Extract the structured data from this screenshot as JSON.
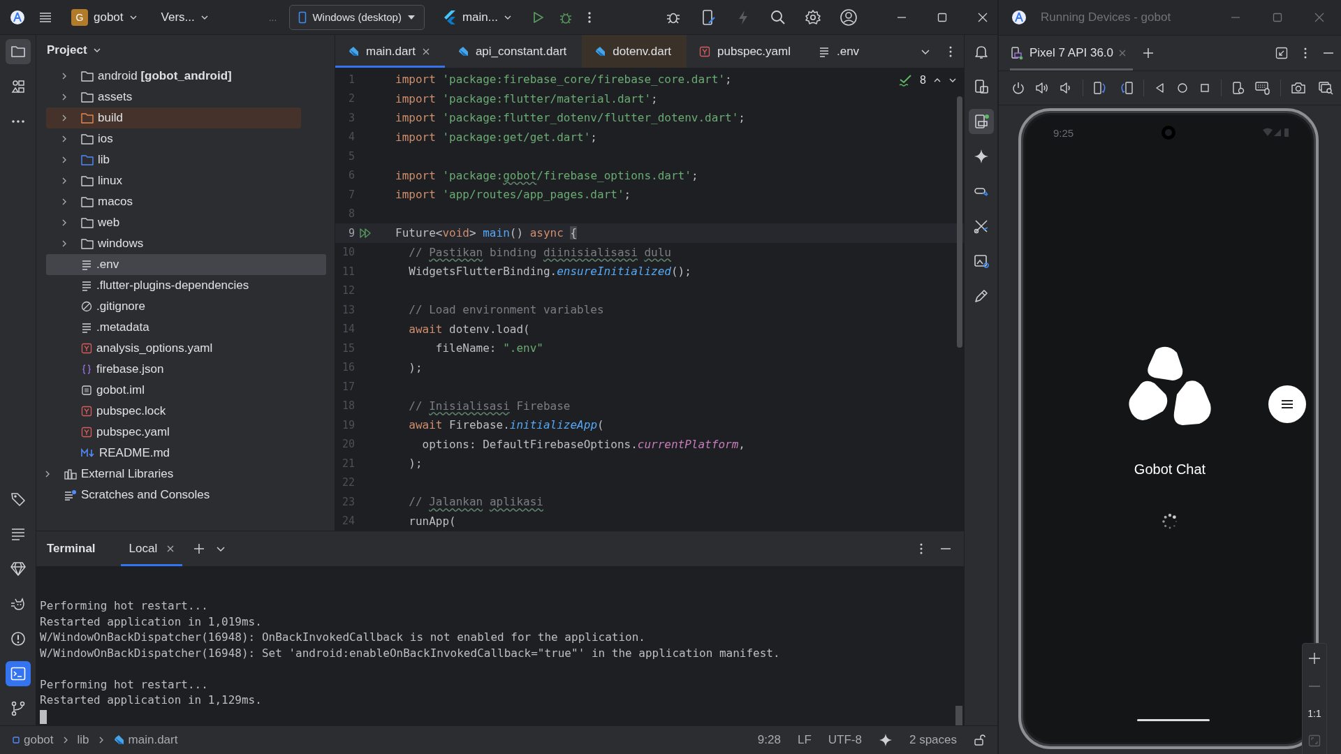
{
  "toolbar": {
    "badge": "G",
    "project": "gobot",
    "vcs": "Vers...",
    "overflow": "...",
    "device": "Windows (desktop)",
    "run_config": "main..."
  },
  "left_strip": {
    "top": [
      {
        "selected": true
      },
      {
        "selected": false
      },
      {
        "selected": false
      }
    ],
    "bottom": [
      {
        "selected": false
      },
      {
        "selected": false
      },
      {
        "selected": false
      },
      {
        "selected": false
      },
      {
        "selected": false
      },
      {
        "selected": true
      },
      {
        "selected": false
      }
    ]
  },
  "right_strip": [
    {
      "selected": false
    },
    {
      "selected": false
    },
    {
      "selected": true
    },
    {
      "selected": false
    },
    {
      "selected": false
    },
    {
      "selected": false
    },
    {
      "selected": false
    },
    {
      "selected": false
    }
  ],
  "project": {
    "title": "Project",
    "tree": [
      {
        "label": "android **[gobot_android]**",
        "kind": "folder",
        "expanded": false,
        "selected": false
      },
      {
        "label": "assets",
        "kind": "folder",
        "expanded": false,
        "selected": false
      },
      {
        "label": "build",
        "kind": "excluded_folder",
        "expanded": false,
        "selected": false
      },
      {
        "label": "ios",
        "kind": "folder",
        "expanded": false,
        "selected": false
      },
      {
        "label": "lib",
        "kind": "source_folder",
        "expanded": false,
        "selected": false
      },
      {
        "label": "linux",
        "kind": "folder",
        "expanded": false,
        "selected": false
      },
      {
        "label": "macos",
        "kind": "folder",
        "expanded": false,
        "selected": false
      },
      {
        "label": "web",
        "kind": "folder",
        "expanded": false,
        "selected": false
      },
      {
        "label": "windows",
        "kind": "folder",
        "expanded": false,
        "selected": false
      },
      {
        "label": ".env",
        "kind": "text",
        "selected": true
      },
      {
        "label": ".flutter-plugins-dependencies",
        "kind": "text",
        "selected": false
      },
      {
        "label": ".gitignore",
        "kind": "ignore",
        "selected": false
      },
      {
        "label": ".metadata",
        "kind": "text",
        "selected": false
      },
      {
        "label": "analysis_options.yaml",
        "kind": "yaml",
        "selected": false
      },
      {
        "label": "firebase.json",
        "kind": "json",
        "selected": false
      },
      {
        "label": "gobot.iml",
        "kind": "iml",
        "selected": false
      },
      {
        "label": "pubspec.lock",
        "kind": "yaml",
        "selected": false
      },
      {
        "label": "pubspec.yaml",
        "kind": "yaml",
        "selected": false
      },
      {
        "label": "README.md",
        "kind": "markdown",
        "selected": false
      }
    ],
    "extra": [
      {
        "label": "External Libraries",
        "kind": "libraries",
        "expanded": false,
        "selected": false
      },
      {
        "label": "Scratches and Consoles",
        "kind": "scratches",
        "selected": false
      }
    ]
  },
  "editor": {
    "tabs": [
      {
        "label": "main.dart",
        "kind": "dart",
        "selected": true,
        "closable": true,
        "excluded": false
      },
      {
        "label": "api_constant.dart",
        "kind": "dart",
        "selected": false,
        "closable": false,
        "excluded": false
      },
      {
        "label": "dotenv.dart",
        "kind": "dart",
        "selected": false,
        "closable": false,
        "excluded": true
      },
      {
        "label": "pubspec.yaml",
        "kind": "yaml",
        "selected": false,
        "closable": false,
        "excluded": false
      },
      {
        "label": ".env",
        "kind": "text",
        "selected": false,
        "closable": false,
        "excluded": false
      }
    ],
    "inspections": "8",
    "lines": [
      {
        "n": "1",
        "current": false,
        "run": false,
        "tokens": [
          {
            "t": "import ",
            "kind": "kw"
          },
          {
            "t": "'package:firebase_core/firebase_core.dart'",
            "kind": "str"
          },
          {
            "t": ";",
            "kind": "p"
          }
        ]
      },
      {
        "n": "2",
        "current": false,
        "run": false,
        "tokens": [
          {
            "t": "import ",
            "kind": "kw"
          },
          {
            "t": "'package:flutter/material.dart'",
            "kind": "str"
          },
          {
            "t": ";",
            "kind": "p"
          }
        ]
      },
      {
        "n": "3",
        "current": false,
        "run": false,
        "tokens": [
          {
            "t": "import ",
            "kind": "kw"
          },
          {
            "t": "'package:flutter_dotenv/flutter_dotenv.dart'",
            "kind": "str"
          },
          {
            "t": ";",
            "kind": "p"
          }
        ]
      },
      {
        "n": "4",
        "current": false,
        "run": false,
        "tokens": [
          {
            "t": "import ",
            "kind": "kw"
          },
          {
            "t": "'package:get/get.dart'",
            "kind": "str"
          },
          {
            "t": ";",
            "kind": "p"
          }
        ]
      },
      {
        "n": "5",
        "current": false,
        "run": false
      },
      {
        "n": "6",
        "current": false,
        "run": false,
        "tokens": [
          {
            "t": "import ",
            "kind": "kw"
          },
          {
            "t": "'package:",
            "kind": "str"
          },
          {
            "t": "gobot",
            "kind": "str_typo"
          },
          {
            "t": "/firebase_options.dart'",
            "kind": "str"
          },
          {
            "t": ";",
            "kind": "p"
          }
        ]
      },
      {
        "n": "7",
        "current": false,
        "run": false,
        "tokens": [
          {
            "t": "import ",
            "kind": "kw"
          },
          {
            "t": "'app/routes/app_pages.dart'",
            "kind": "str"
          },
          {
            "t": ";",
            "kind": "p"
          }
        ]
      },
      {
        "n": "8",
        "current": false,
        "run": false
      },
      {
        "n": "9",
        "current": true,
        "run": true,
        "tokens": [
          {
            "t": "Future<",
            "kind": "p"
          },
          {
            "t": "void",
            "kind": "kw"
          },
          {
            "t": "> ",
            "kind": "p"
          },
          {
            "t": "main",
            "kind": "fn"
          },
          {
            "t": "() ",
            "kind": "p"
          },
          {
            "t": "async ",
            "kind": "kw"
          },
          {
            "t": "{",
            "kind": "brace"
          }
        ]
      },
      {
        "n": "10",
        "current": false,
        "run": false,
        "tokens": [
          {
            "t": "  // ",
            "kind": "cm"
          },
          {
            "t": "Pastikan",
            "kind": "cm_typo"
          },
          {
            "t": " binding ",
            "kind": "cm"
          },
          {
            "t": "diinisialisasi",
            "kind": "cm_typo"
          },
          {
            "t": " dulu",
            "kind": "cm_typo"
          }
        ]
      },
      {
        "n": "11",
        "current": false,
        "run": false,
        "tokens": [
          {
            "t": "  WidgetsFlutterBinding.",
            "kind": "p"
          },
          {
            "t": "ensureInitialized",
            "kind": "it"
          },
          {
            "t": "();",
            "kind": "p"
          }
        ]
      },
      {
        "n": "12",
        "current": false,
        "run": false
      },
      {
        "n": "13",
        "current": false,
        "run": false,
        "tokens": [
          {
            "t": "  // Load environment variables",
            "kind": "cm"
          }
        ]
      },
      {
        "n": "14",
        "current": false,
        "run": false,
        "tokens": [
          {
            "t": "  await",
            "kind": "kw"
          },
          {
            "t": " dotenv.load(",
            "kind": "p"
          }
        ]
      },
      {
        "n": "15",
        "current": false,
        "run": false,
        "tokens": [
          {
            "t": "      fileName: ",
            "kind": "p"
          },
          {
            "t": "\".env\"",
            "kind": "str"
          }
        ]
      },
      {
        "n": "16",
        "current": false,
        "run": false,
        "tokens": [
          {
            "t": "  );",
            "kind": "p"
          }
        ]
      },
      {
        "n": "17",
        "current": false,
        "run": false
      },
      {
        "n": "18",
        "current": false,
        "run": false,
        "tokens": [
          {
            "t": "  // ",
            "kind": "cm"
          },
          {
            "t": "Inisialisasi",
            "kind": "cm_typo"
          },
          {
            "t": " Firebase",
            "kind": "cm"
          }
        ]
      },
      {
        "n": "19",
        "current": false,
        "run": false,
        "tokens": [
          {
            "t": "  await",
            "kind": "kw"
          },
          {
            "t": " Firebase.",
            "kind": "p"
          },
          {
            "t": "initializeApp",
            "kind": "it"
          },
          {
            "t": "(",
            "kind": "p"
          }
        ]
      },
      {
        "n": "20",
        "current": false,
        "run": false,
        "tokens": [
          {
            "t": "    options: DefaultFirebaseOptions.",
            "kind": "p"
          },
          {
            "t": "currentPlatform",
            "kind": "prop"
          },
          {
            "t": ",",
            "kind": "p"
          }
        ]
      },
      {
        "n": "21",
        "current": false,
        "run": false,
        "tokens": [
          {
            "t": "  );",
            "kind": "p"
          }
        ]
      },
      {
        "n": "22",
        "current": false,
        "run": false
      },
      {
        "n": "23",
        "current": false,
        "run": false,
        "tokens": [
          {
            "t": "  // ",
            "kind": "cm"
          },
          {
            "t": "Jalankan",
            "kind": "cm_typo"
          },
          {
            "t": " aplikasi",
            "kind": "cm_typo"
          }
        ]
      },
      {
        "n": "24",
        "current": false,
        "run": false,
        "tokens": [
          {
            "t": "  runApp(",
            "kind": "p"
          }
        ]
      }
    ]
  },
  "terminal": {
    "title": "Terminal",
    "tabs": [
      {
        "label": "Local",
        "selected": true
      }
    ],
    "blocks": [
      [
        "Performing hot restart...",
        "Restarted application in 1,019ms.",
        "W/WindowOnBackDispatcher(16948): OnBackInvokedCallback is not enabled for the application.",
        "W/WindowOnBackDispatcher(16948): Set 'android:enableOnBackInvokedCallback=\"true\"' in the application manifest."
      ],
      [
        "Performing hot restart...",
        "Restarted application in 1,129ms."
      ]
    ]
  },
  "status_bar": {
    "breadcrumbs": [
      {
        "label": "gobot",
        "kind": "module"
      },
      {
        "label": "lib",
        "kind": "folder"
      },
      {
        "label": "main.dart",
        "kind": "dart"
      }
    ],
    "items": [
      "9:28",
      "LF",
      "UTF-8",
      "2 spaces"
    ]
  },
  "running_devices": {
    "title": "Running Devices - gobot",
    "tabs": [
      {
        "label": "Pixel 7 API 36.0",
        "selected": true
      }
    ],
    "phone": {
      "time": "9:25",
      "app_title": "Gobot Chat"
    },
    "zoom_reset": "1:1"
  }
}
